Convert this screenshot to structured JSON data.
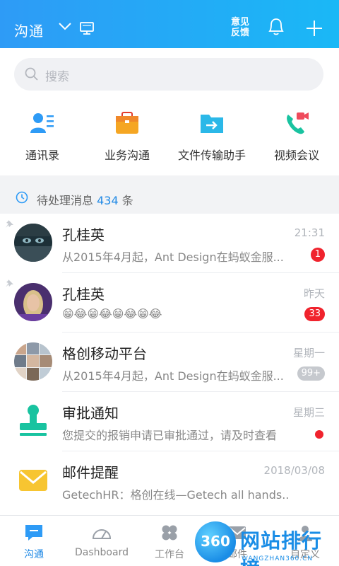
{
  "header": {
    "title": "沟通",
    "feedback_label": "意见\n反馈",
    "icons": [
      "chevron-down-icon",
      "screen-icon",
      "bell-icon",
      "plus-icon"
    ]
  },
  "search": {
    "placeholder": "搜索"
  },
  "quick_actions": [
    {
      "label": "通讯录",
      "icon": "contacts-icon",
      "color": "#2e9bf6"
    },
    {
      "label": "业务沟通",
      "icon": "briefcase-icon",
      "color": "#f5a623"
    },
    {
      "label": "文件传输助手",
      "icon": "folder-transfer-icon",
      "color": "#2bb8e8"
    },
    {
      "label": "视频会议",
      "icon": "video-call-icon",
      "color": "#19c3a0"
    }
  ],
  "pending": {
    "prefix": "待处理消息",
    "count": "434",
    "suffix": "条"
  },
  "conversations": [
    {
      "name": "孔桂英",
      "preview": "从2015年4月起，Ant Design在蚂蚁金服...",
      "time": "21:31",
      "badge": "1",
      "pinned": true
    },
    {
      "name": "孔桂英",
      "preview": "😁😂😁😂😁😂😁😂",
      "time": "昨天",
      "badge": "33",
      "pinned": true
    },
    {
      "name": "格创移动平台",
      "preview": "从2015年4月起，Ant Design在蚂蚁金服...",
      "time": "星期一",
      "badge": "99+",
      "pinned": false
    },
    {
      "name": "审批通知",
      "preview": "您提交的报销申请已审批通过，请及时查看",
      "time": "星期三",
      "badge": "",
      "pinned": false
    },
    {
      "name": "邮件提醒",
      "preview": "GetechHR：格创在线—Getech all hands...",
      "time": "2018/03/08",
      "badge": "",
      "pinned": false
    }
  ],
  "tabs": [
    {
      "label": "沟通",
      "icon": "chat-icon",
      "active": true
    },
    {
      "label": "Dashboard",
      "icon": "dashboard-icon",
      "active": false
    },
    {
      "label": "工作台",
      "icon": "workbench-icon",
      "active": false
    },
    {
      "label": "邮件",
      "icon": "mail-icon",
      "active": false
    },
    {
      "label": "自定义",
      "icon": "profile-icon",
      "active": false
    }
  ],
  "watermark": {
    "logo_number": "360",
    "text": "网站排行榜",
    "url": "WANGZHAN360.CN"
  },
  "colors": {
    "header_start": "#2e9bf6",
    "header_end": "#1ab8f6",
    "accent": "#1e88e5",
    "badge_red": "#f0232d"
  }
}
